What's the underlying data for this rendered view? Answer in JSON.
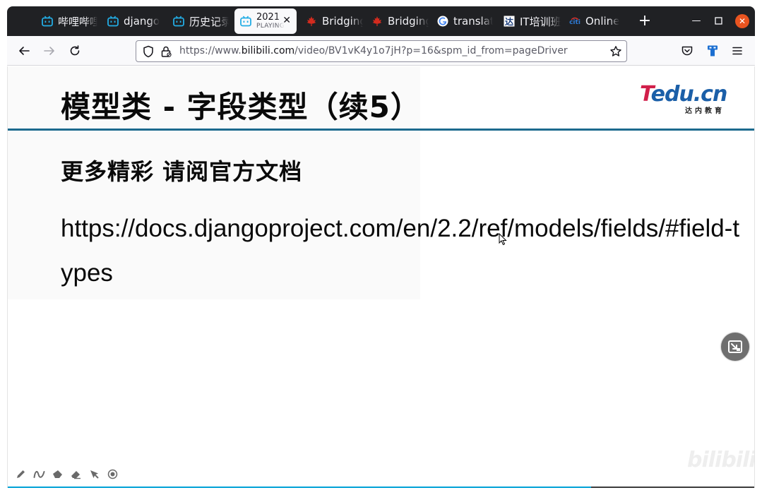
{
  "browser": {
    "tabs": [
      {
        "title": "哔哩哔哩",
        "icon": "bilibili-icon"
      },
      {
        "title": "django",
        "icon": "bilibili-icon"
      },
      {
        "title": "历史记录",
        "icon": "bilibili-icon"
      },
      {
        "title": "2021",
        "subtitle": "PLAYING",
        "icon": "bilibili-icon",
        "active": true
      },
      {
        "title": "Bridging",
        "icon": "maple-leaf-icon"
      },
      {
        "title": "Bridging",
        "icon": "maple-leaf-icon"
      },
      {
        "title": "translat",
        "icon": "google-icon"
      },
      {
        "title": "IT培训班",
        "icon": "da-logo-icon"
      },
      {
        "title": "Online",
        "icon": "citi-icon"
      }
    ],
    "url": {
      "scheme": "https://www.",
      "host": "bilibili.com",
      "path": "/video/BV1vK4y1o7jH?p=16&spm_id_from=pageDriver"
    },
    "colors": {
      "chrome_dark": "#202124",
      "accent_close": "#e95420"
    }
  },
  "slide": {
    "title": "模型类 - 字段类型（续5）",
    "logo": {
      "t": "T",
      "rest": "edu.cn",
      "sub": "达内教育"
    },
    "heading": "更多精彩 请阅官方文档",
    "link": "https://docs.djangoproject.com/en/2.2/ref/models/fields/#field-types",
    "colors": {
      "rule": "#1c6a8e",
      "logo_red": "#d11f4a",
      "logo_blue": "#1b5fa8"
    }
  },
  "player": {
    "tools": [
      "pen-icon",
      "curve-icon",
      "marker-icon",
      "eraser-icon",
      "pointer-icon",
      "record-icon"
    ],
    "watermark": "bilibili",
    "progress": 0.78
  }
}
